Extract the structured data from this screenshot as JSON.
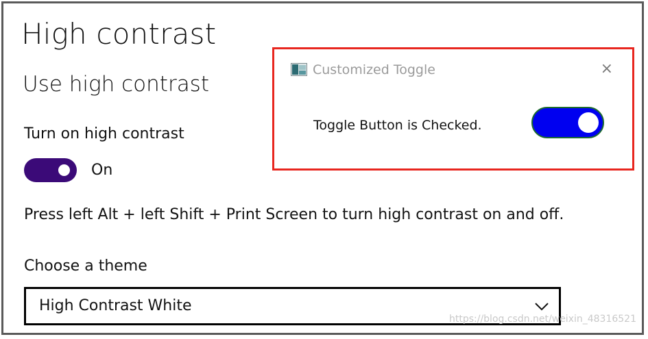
{
  "settings": {
    "page_title": "High contrast",
    "section_title": "Use high contrast",
    "toggle": {
      "label": "Turn on high contrast",
      "state_text": "On",
      "checked": true,
      "color": "#3b0a78"
    },
    "shortcut_text": "Press left Alt + left Shift + Print Screen to turn high contrast on and off.",
    "theme": {
      "label": "Choose a theme",
      "selected": "High Contrast White",
      "icon": "chevron-down-icon"
    }
  },
  "popup": {
    "title": "Customized Toggle",
    "app_icon": "window-app-icon",
    "close_icon": "close-icon",
    "close_glyph": "×",
    "message": "Toggle Button is Checked.",
    "toggle_checked": true,
    "toggle_color": "#0000f0",
    "toggle_border_color": "#1d6b2f",
    "highlight_color": "#e8261f"
  },
  "watermark": "https://blog.csdn.net/weixin_48316521"
}
